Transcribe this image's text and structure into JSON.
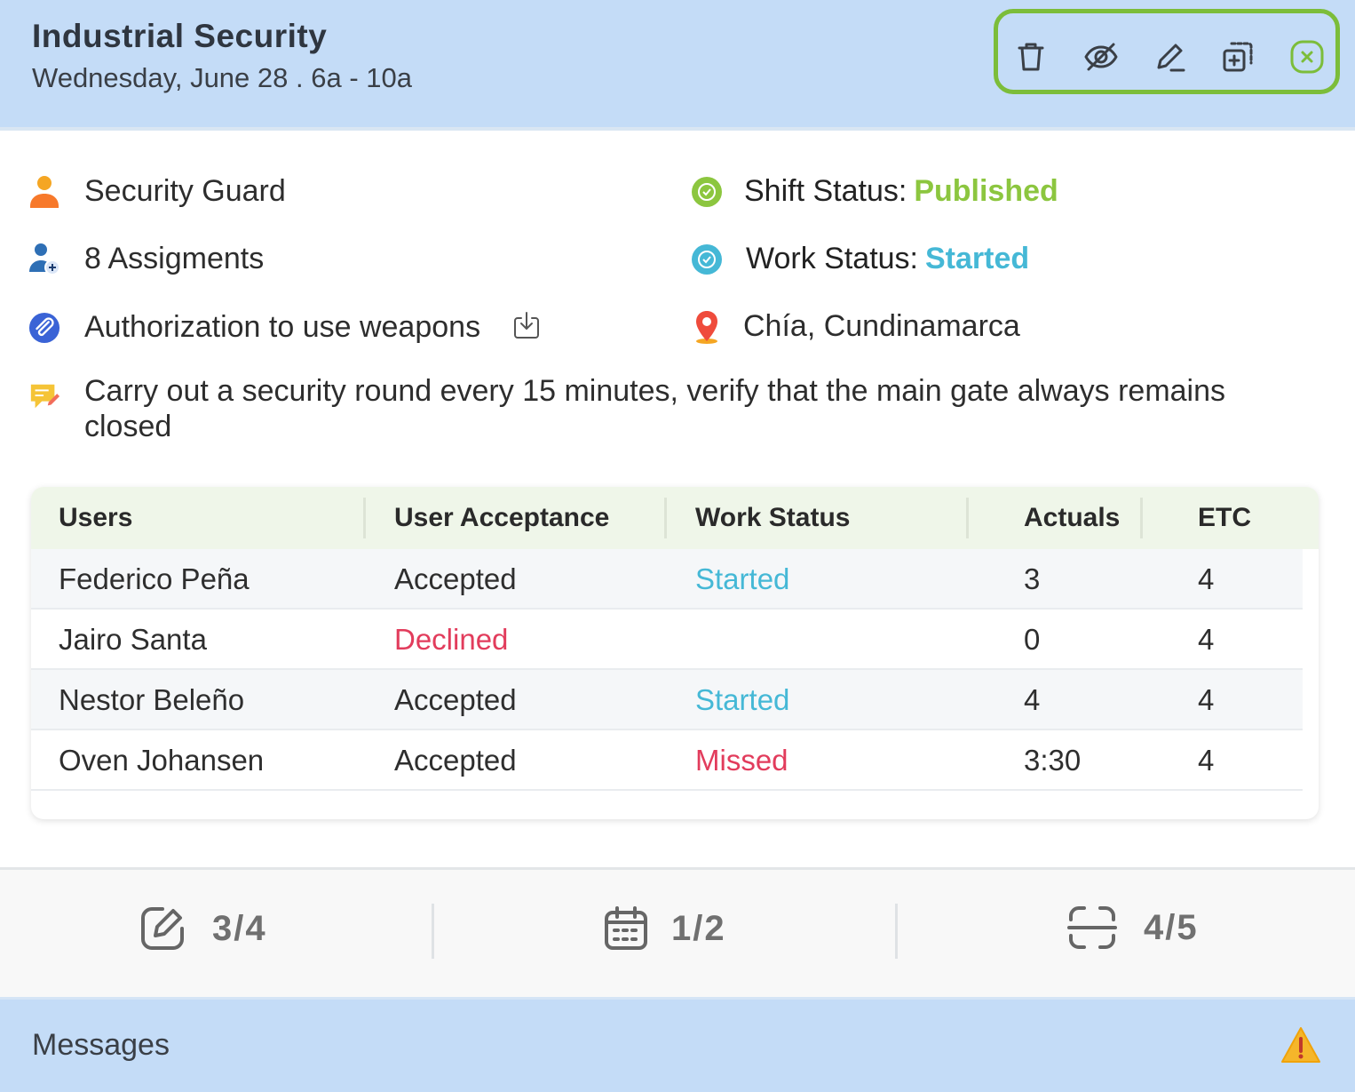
{
  "header": {
    "title": "Industrial Security",
    "subtitle": "Wednesday, June 28 . 6a - 10a",
    "toolbar": [
      "trash-icon",
      "eye-off-icon",
      "pencil-icon",
      "duplicate-icon",
      "close-icon"
    ]
  },
  "details": {
    "role": "Security Guard",
    "assignments": "8 Assigments",
    "attachment": "Authorization to use weapons",
    "note": "Carry out a security round every 15 minutes, verify that the main gate always remains closed",
    "shift_status_label": "Shift Status:",
    "shift_status_value": "Published",
    "work_status_label": "Work Status:",
    "work_status_value": "Started",
    "location": "Chía, Cundinamarca"
  },
  "table": {
    "headers": [
      "Users",
      "User Acceptance",
      "Work Status",
      "Actuals",
      "ETC"
    ],
    "rows": [
      {
        "user": "Federico Peña",
        "acceptance": "Accepted",
        "work_status": "Started",
        "actuals": "3",
        "etc": "4"
      },
      {
        "user": "Jairo Santa",
        "acceptance": "Declined",
        "work_status": "",
        "actuals": "0",
        "etc": "4"
      },
      {
        "user": "Nestor Beleño",
        "acceptance": "Accepted",
        "work_status": "Started",
        "actuals": "4",
        "etc": "4"
      },
      {
        "user": "Oven Johansen",
        "acceptance": "Accepted",
        "work_status": "Missed",
        "actuals": "3:30",
        "etc": "4"
      }
    ]
  },
  "stats": [
    {
      "icon": "edit-square-icon",
      "value": "3/4"
    },
    {
      "icon": "calendar-icon",
      "value": "1/2"
    },
    {
      "icon": "scan-icon",
      "value": "4/5"
    }
  ],
  "messages": {
    "label": "Messages",
    "icon": "warning-icon"
  },
  "colors": {
    "header_bg": "#c4dcf7",
    "toolbar_border": "#7cbd3a",
    "published": "#8cc63f",
    "started": "#45b8d6",
    "declined": "#e23c5c",
    "missed": "#e23c5c"
  }
}
